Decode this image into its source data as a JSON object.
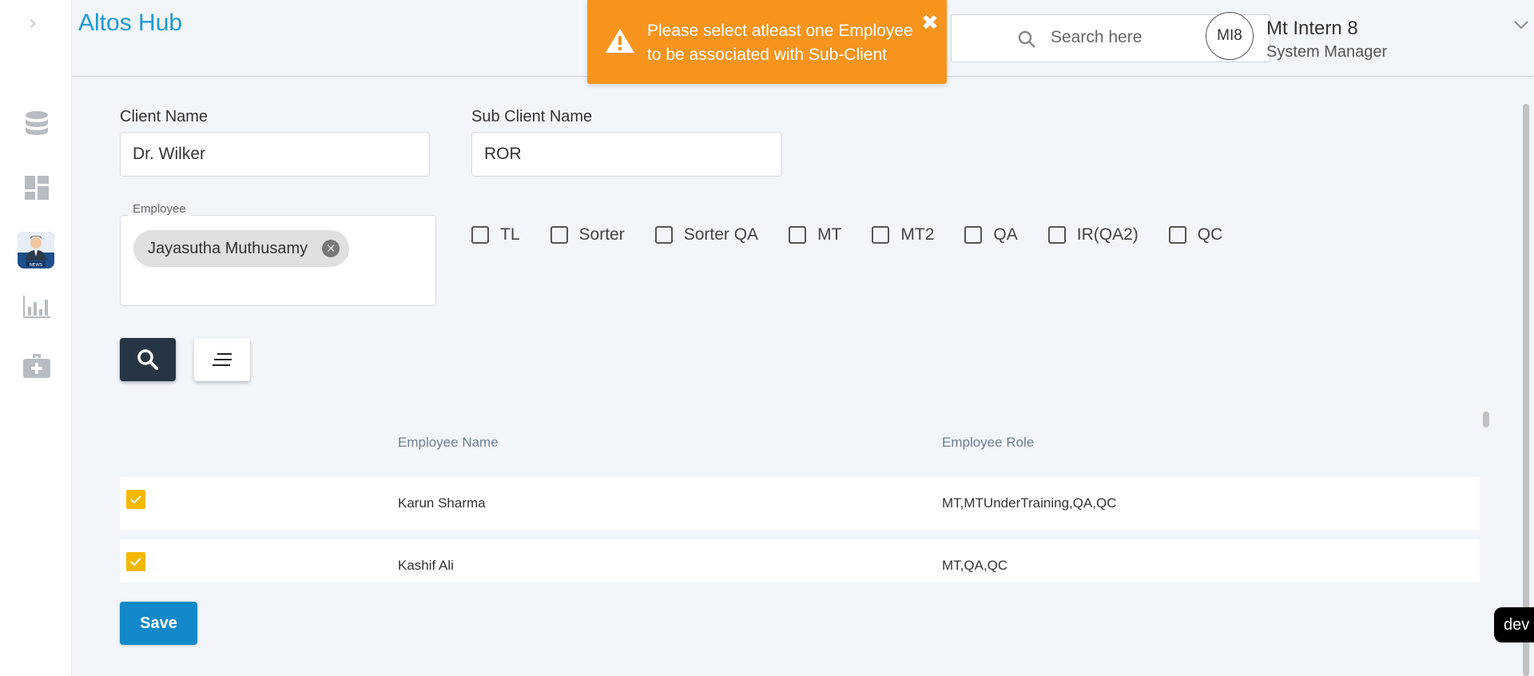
{
  "app": {
    "brand": "Altos Hub"
  },
  "sidebar": {
    "expand_icon": "chevron-right-icon",
    "items": [
      {
        "name": "database-icon"
      },
      {
        "name": "dashboard-icon"
      },
      {
        "name": "news-avatar-icon",
        "badge": "NEWS"
      },
      {
        "name": "bar-chart-icon"
      },
      {
        "name": "medkit-icon"
      }
    ]
  },
  "header": {
    "search_placeholder": "Search here",
    "avatar_initials": "MI8",
    "user_name": "Mt Intern 8",
    "user_role": "System Manager"
  },
  "toast": {
    "message": "Please select atleast one Employee to be associated with Sub-Client",
    "close": "✖",
    "color": "#f7941d"
  },
  "form": {
    "client_label": "Client Name",
    "client_value": "Dr. Wilker",
    "subclient_label": "Sub Client Name",
    "subclient_value": "ROR",
    "employee_legend": "Employee",
    "employee_chip": "Jayasutha Muthusamy",
    "roles": [
      "TL",
      "Sorter",
      "Sorter QA",
      "MT",
      "MT2",
      "QA",
      "IR(QA2)",
      "QC"
    ]
  },
  "table": {
    "col_name": "Employee Name",
    "col_role": "Employee Role",
    "rows": [
      {
        "name": "Karun Sharma",
        "role": "MT,MTUnderTraining,QA,QC",
        "checked": true
      },
      {
        "name": "Kashif Ali",
        "role": "MT,QA,QC",
        "checked": true
      }
    ]
  },
  "actions": {
    "save": "Save"
  },
  "env_badge": "dev",
  "colors": {
    "accent": "#1a9ad6",
    "save": "#1389c9",
    "search_btn": "#263544",
    "checkbox": "#f5b800"
  }
}
